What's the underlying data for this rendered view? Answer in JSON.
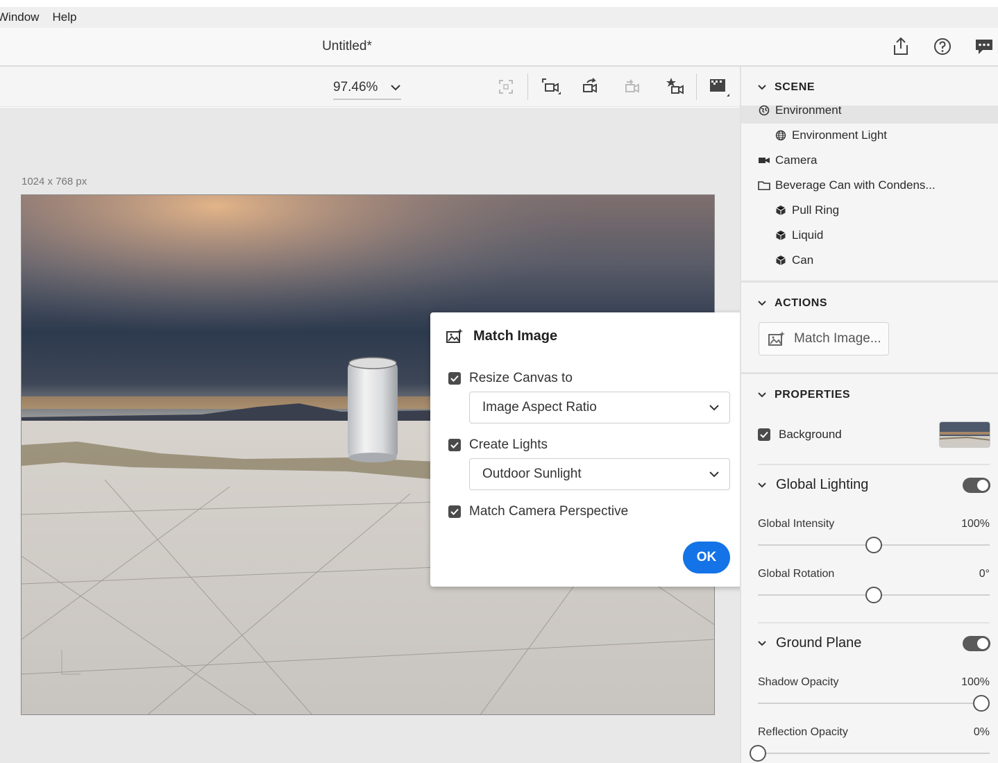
{
  "menu": {
    "items": [
      "Window",
      "Help"
    ]
  },
  "title": {
    "document": "Untitled*"
  },
  "toolbar": {
    "zoom": "97.46%"
  },
  "canvas": {
    "size_label": "1024 x 768 px"
  },
  "scene": {
    "heading": "SCENE",
    "items": [
      {
        "label": "Environment",
        "icon": "environment-icon"
      },
      {
        "label": "Environment Light",
        "icon": "globe-icon"
      },
      {
        "label": "Camera",
        "icon": "camera-icon"
      },
      {
        "label": "Beverage Can with Condens...",
        "icon": "folder-icon"
      },
      {
        "label": "Pull Ring",
        "icon": "cube-icon"
      },
      {
        "label": "Liquid",
        "icon": "cube-icon"
      },
      {
        "label": "Can",
        "icon": "cube-icon"
      }
    ]
  },
  "actions": {
    "heading": "ACTIONS",
    "match_image_label": "Match Image..."
  },
  "properties": {
    "heading": "PROPERTIES",
    "background_label": "Background",
    "background_checked": true,
    "global_lighting": {
      "title": "Global Lighting",
      "enabled": true,
      "intensity_label": "Global Intensity",
      "intensity_value": "100%",
      "intensity_fraction": 0.5,
      "rotation_label": "Global Rotation",
      "rotation_value": "0°",
      "rotation_fraction": 0.5
    },
    "ground_plane": {
      "title": "Ground Plane",
      "enabled": true,
      "shadow_label": "Shadow Opacity",
      "shadow_value": "100%",
      "shadow_fraction": 1.0,
      "reflection_label": "Reflection Opacity",
      "reflection_value": "0%",
      "reflection_fraction": 0.0
    }
  },
  "dialog": {
    "title": "Match Image",
    "resize_label": "Resize Canvas to",
    "resize_checked": true,
    "resize_option": "Image Aspect Ratio",
    "lights_label": "Create Lights",
    "lights_checked": true,
    "lights_option": "Outdoor Sunlight",
    "camera_label": "Match Camera Perspective",
    "camera_checked": true,
    "ok_label": "OK"
  },
  "colors": {
    "accent": "#1473e6",
    "panel": "#f5f5f5",
    "canvas_bg": "#e8e8e8"
  }
}
